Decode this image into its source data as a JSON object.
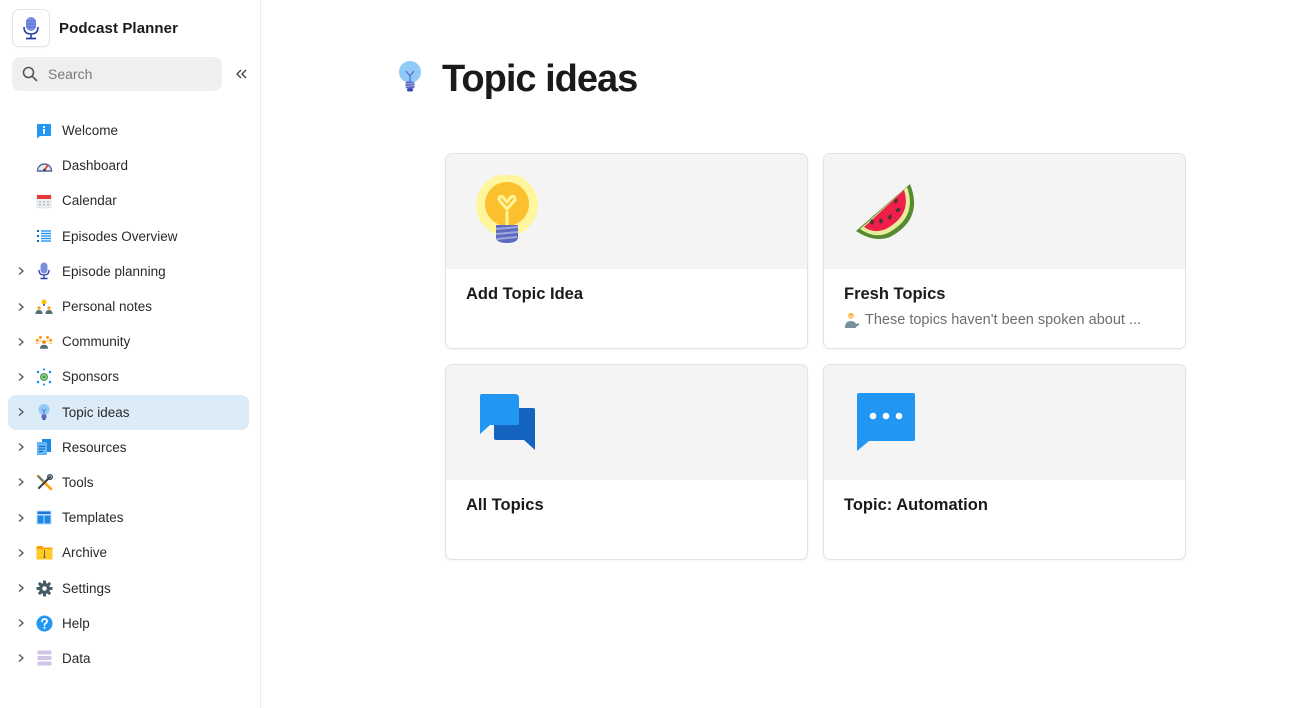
{
  "app": {
    "title": "Podcast Planner",
    "logo_icon": "microphone-icon"
  },
  "search": {
    "placeholder": "Search",
    "value": ""
  },
  "sidebar": {
    "collapse_icon": "double-chevron-left-icon",
    "items": [
      {
        "label": "Welcome",
        "icon": "info-icon",
        "expandable": false,
        "active": false
      },
      {
        "label": "Dashboard",
        "icon": "speedometer-icon",
        "expandable": false,
        "active": false
      },
      {
        "label": "Calendar",
        "icon": "calendar-icon",
        "expandable": false,
        "active": false
      },
      {
        "label": "Episodes Overview",
        "icon": "list-icon",
        "expandable": false,
        "active": false
      },
      {
        "label": "Episode planning",
        "icon": "microphone-icon",
        "expandable": true,
        "active": false
      },
      {
        "label": "Personal notes",
        "icon": "people-idea-icon",
        "expandable": true,
        "active": false
      },
      {
        "label": "Community",
        "icon": "group-icon",
        "expandable": true,
        "active": false
      },
      {
        "label": "Sponsors",
        "icon": "sponsor-network-icon",
        "expandable": true,
        "active": false
      },
      {
        "label": "Topic ideas",
        "icon": "light-bulb-icon",
        "expandable": true,
        "active": true
      },
      {
        "label": "Resources",
        "icon": "documents-icon",
        "expandable": true,
        "active": false
      },
      {
        "label": "Tools",
        "icon": "tools-icon",
        "expandable": true,
        "active": false
      },
      {
        "label": "Templates",
        "icon": "template-icon",
        "expandable": true,
        "active": false
      },
      {
        "label": "Archive",
        "icon": "archive-folder-icon",
        "expandable": true,
        "active": false
      },
      {
        "label": "Settings",
        "icon": "gear-icon",
        "expandable": true,
        "active": false
      },
      {
        "label": "Help",
        "icon": "help-icon",
        "expandable": true,
        "active": false
      },
      {
        "label": "Data",
        "icon": "database-icon",
        "expandable": true,
        "active": false
      }
    ]
  },
  "page": {
    "title": "Topic ideas",
    "icon": "light-bulb-icon"
  },
  "cards": [
    {
      "title": "Add Topic Idea",
      "cover_icon": "glowing-light-bulb-icon",
      "description": ""
    },
    {
      "title": "Fresh Topics",
      "cover_icon": "watermelon-icon",
      "description": "These topics haven't been spoken about ...",
      "description_icon": "person-tipping-hand-icon"
    },
    {
      "title": "All Topics",
      "cover_icon": "chat-bubbles-icon",
      "description": ""
    },
    {
      "title": "Topic: Automation",
      "cover_icon": "chat-dots-icon",
      "description": ""
    }
  ],
  "colors": {
    "active_item_bg": "#dcebf8",
    "accent_blue": "#2196f3",
    "card_cover_bg": "#f4f4f4"
  }
}
